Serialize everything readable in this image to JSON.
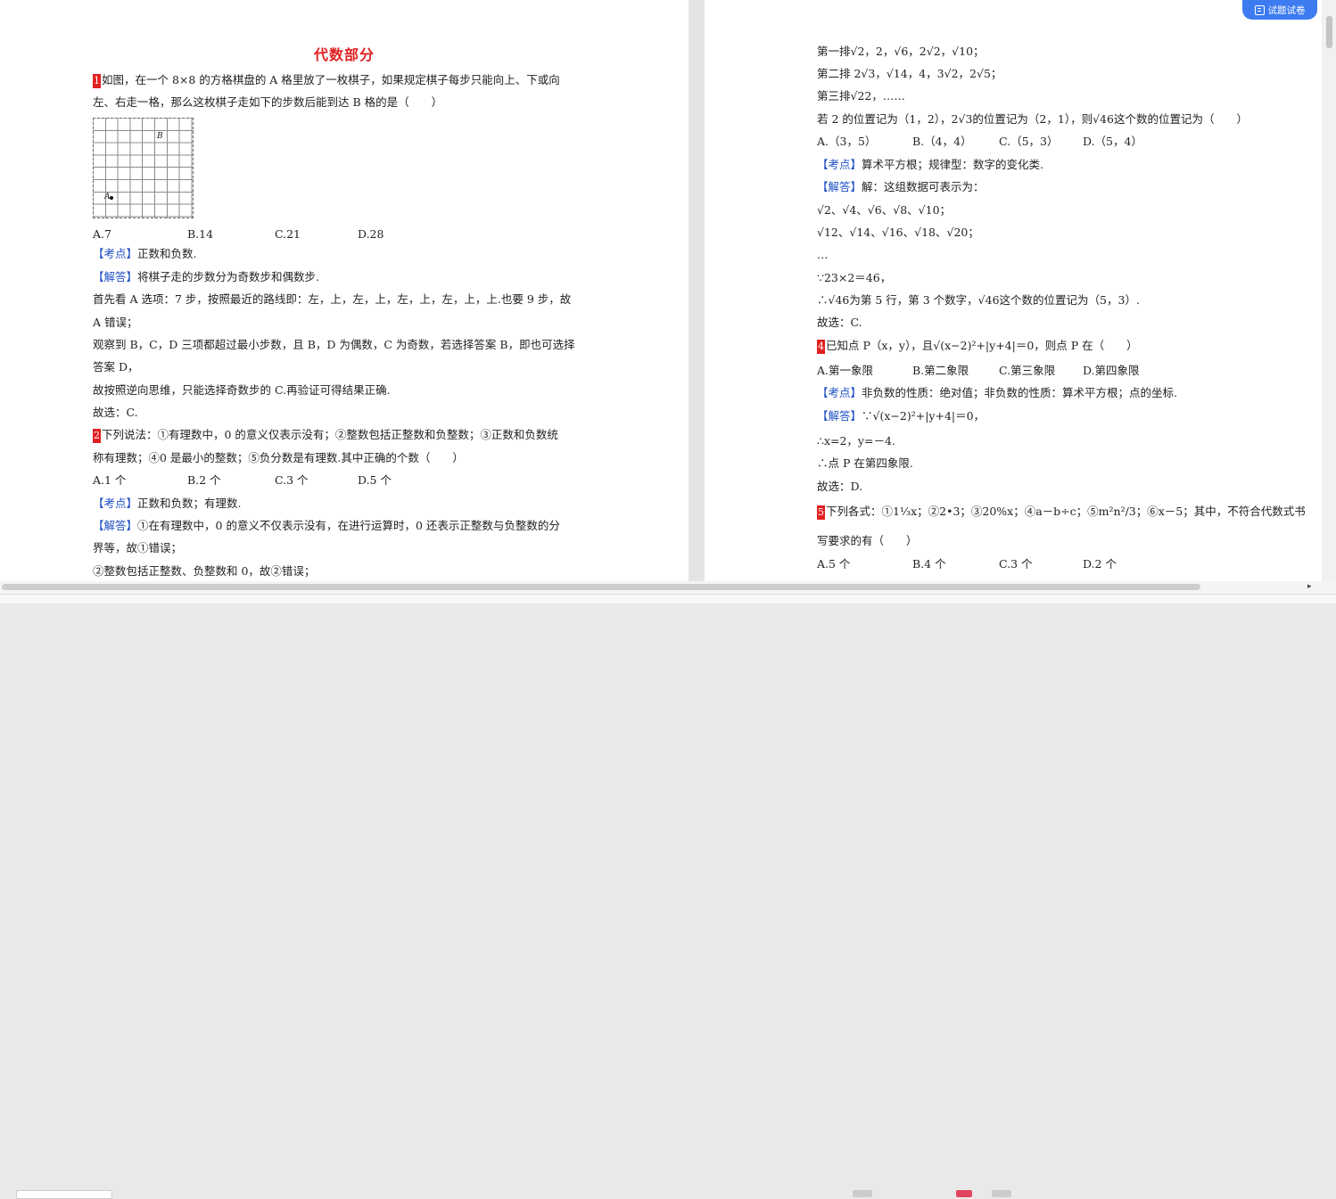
{
  "float_button": {
    "label": "试题试卷"
  },
  "left": {
    "title": "代数部分",
    "q1": {
      "num": "1",
      "stem1": "如图，在一个 8×8 的方格棋盘的 A 格里放了一枚棋子，如果规定棋子每步只能向上、下或向",
      "stem2": "左、右走一格，那么这枚棋子走如下的步数后能到达 B 格的是（　　）",
      "grid_a": "A",
      "grid_b": "B",
      "options": [
        "A.7",
        "B.14",
        "C.21",
        "D.28"
      ],
      "kaodian_tag": "【考点】",
      "kaodian": "正数和负数.",
      "jieda_tag": "【解答】",
      "jieda": "将棋子走的步数分为奇数步和偶数步.",
      "l1": "首先看 A 选项：7 步，按照最近的路线即：左，上，左，上，左，上，左，上，上.也要 9 步，故",
      "l2": "A 错误；",
      "l3": "观察到 B，C，D 三项都超过最小步数，且 B，D 为偶数，C 为奇数，若选择答案 B，即也可选择",
      "l4": "答案 D，",
      "l5": "故按照逆向思维，只能选择奇数步的 C.再验证可得结果正确.",
      "l6": "故选：C."
    },
    "q2": {
      "num": "2",
      "stem1": "下列说法：①有理数中，0 的意义仅表示没有；②整数包括正整数和负整数；③正数和负数统",
      "stem2": "称有理数；④0 是最小的整数；⑤负分数是有理数.其中正确的个数（　　）",
      "options": [
        "A.1 个",
        "B.2 个",
        "C.3 个",
        "D.5 个"
      ],
      "kaodian_tag": "【考点】",
      "kaodian": "正数和负数；有理数.",
      "jieda_tag": "【解答】",
      "jieda": "①在有理数中，0 的意义不仅表示没有，在进行运算时，0 还表示正整数与负整数的分",
      "l1": "界等，故①错误；",
      "l2": "②整数包括正整数、负整数和 0，故②错误；"
    }
  },
  "right": {
    "r1": "第一排√2，2，√6，2√2，√10；",
    "r2": "第二排 2√3，√14，4，3√2，2√5；",
    "r3": "第三排√22，……",
    "r4": "若 2 的位置记为（1，2），2√3的位置记为（2，1），则√46这个数的位置记为（　　）",
    "q3_options": [
      "A.（3，5）",
      "B.（4，4）",
      "C.（5，3）",
      "D.（5，4）"
    ],
    "q3_kaodian_tag": "【考点】",
    "q3_kaodian": "算术平方根；规律型：数字的变化类.",
    "q3_jieda_tag": "【解答】",
    "q3_jieda": "解：这组数据可表示为：",
    "q3_l1": "√2、√4、√6、√8、√10；",
    "q3_l2": "√12、√14、√16、√18、√20；",
    "q3_l3": "…",
    "q3_l4": "∵23×2＝46，",
    "q3_l5": "∴√46为第 5 行，第 3 个数字，√46这个数的位置记为（5，3）.",
    "q3_l6": "故选：C.",
    "q4": {
      "num": "4",
      "stem": "已知点 P（x，y），且√(x−2)²+|y+4|＝0，则点 P 在（　　）",
      "options": [
        "A.第一象限",
        "B.第二象限",
        "C.第三象限",
        "D.第四象限"
      ],
      "kaodian_tag": "【考点】",
      "kaodian": "非负数的性质：绝对值；非负数的性质：算术平方根；点的坐标.",
      "jieda_tag": "【解答】",
      "jieda": "∵√(x−2)²+|y+4|＝0，",
      "l1": "∴x=2，y=－4.",
      "l2": "∴点 P 在第四象限.",
      "l3": "故选：D."
    },
    "q5": {
      "num": "5",
      "stem1": "下列各式：①1⅓x；②2•3；③20%x；④a－b÷c；⑤m²n²/3；⑥x－5；其中，不符合代数式书",
      "stem2": "写要求的有（　　）",
      "options": [
        "A.5 个",
        "B.4 个",
        "C.3 个",
        "D.2 个"
      ]
    }
  }
}
